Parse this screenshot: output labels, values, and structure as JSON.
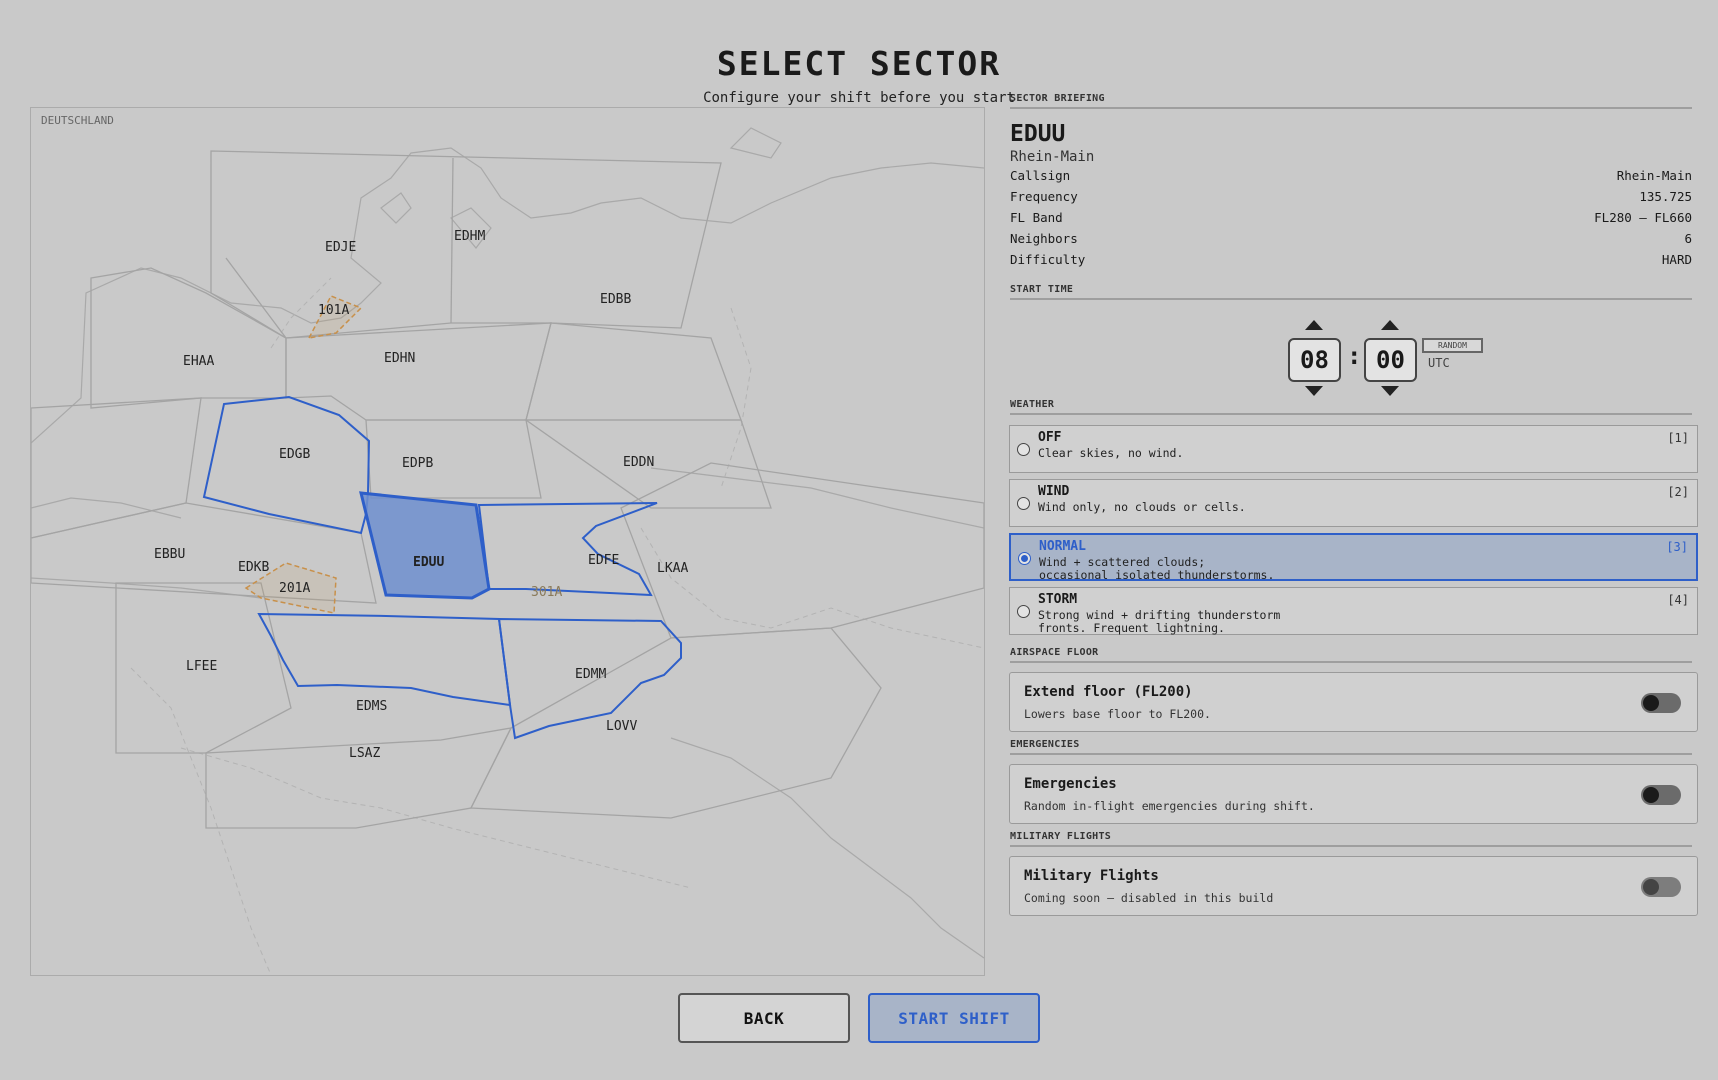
{
  "header": {
    "title": "SELECT SECTOR",
    "subtitle": "Configure your shift before you start"
  },
  "map": {
    "country_label": "DEUTSCHLAND",
    "selected_sector": "EDUU",
    "sector_labels": {
      "edje": "EDJE",
      "edhm": "EDHM",
      "edbb": "EDBB",
      "ehaa": "EHAA",
      "edhn": "EDHN",
      "edgb": "EDGB",
      "edpb": "EDPB",
      "eddn": "EDDN",
      "ebbu": "EBBU",
      "edkb": "EDKB",
      "eduu": "EDUU",
      "edfe": "EDFE",
      "lkaa": "LKAA",
      "lfee": "LFEE",
      "edms": "EDMS",
      "edmm": "EDMM",
      "lovv": "LOVV",
      "lsaz": "LSAZ"
    },
    "restricted_labels": {
      "a101": "101A",
      "a201": "201A",
      "a301": "301A"
    },
    "colors": {
      "selected": "#6e8fcf",
      "outline": "#2e5fc9",
      "restricted": "#c8904a",
      "boundary": "#a4a4a4"
    }
  },
  "briefing": {
    "heading": "SECTOR BRIEFING",
    "sector_id": "EDUU",
    "sector_name": "Rhein-Main",
    "rows": [
      {
        "label": "Callsign",
        "value": "Rhein-Main"
      },
      {
        "label": "Frequency",
        "value": "135.725"
      },
      {
        "label": "FL Band",
        "value": "FL280 – FL660"
      },
      {
        "label": "Neighbors",
        "value": "6"
      },
      {
        "label": "Difficulty",
        "value": "HARD"
      }
    ]
  },
  "start_time": {
    "heading": "START TIME",
    "hours": "08",
    "minutes": "00",
    "separator": ":",
    "random_label": "RANDOM",
    "tz": "UTC"
  },
  "weather": {
    "heading": "WEATHER",
    "selected": "NORMAL",
    "options": [
      {
        "name": "OFF",
        "desc": "Clear skies, no wind.",
        "desc2": "",
        "key": "[1]"
      },
      {
        "name": "WIND",
        "desc": "Wind only, no clouds or cells.",
        "desc2": "",
        "key": "[2]"
      },
      {
        "name": "NORMAL",
        "desc": "Wind + scattered clouds;",
        "desc2": "occasional isolated thunderstorms.",
        "key": "[3]"
      },
      {
        "name": "STORM",
        "desc": "Strong wind + drifting thunderstorm",
        "desc2": "fronts. Frequent lightning.",
        "key": "[4]"
      }
    ]
  },
  "airspace_floor": {
    "heading": "AIRSPACE FLOOR",
    "title": "Extend floor (FL200)",
    "desc": "Lowers base floor to FL200.",
    "enabled": false
  },
  "emergencies": {
    "heading": "EMERGENCIES",
    "title": "Emergencies",
    "desc": "Random in-flight emergencies during shift.",
    "enabled": false
  },
  "military": {
    "heading": "MILITARY FLIGHTS",
    "title": "Military Flights",
    "desc": "Coming soon — disabled in this build",
    "enabled": false
  },
  "footer": {
    "back_label": "BACK",
    "start_label": "START SHIFT"
  }
}
